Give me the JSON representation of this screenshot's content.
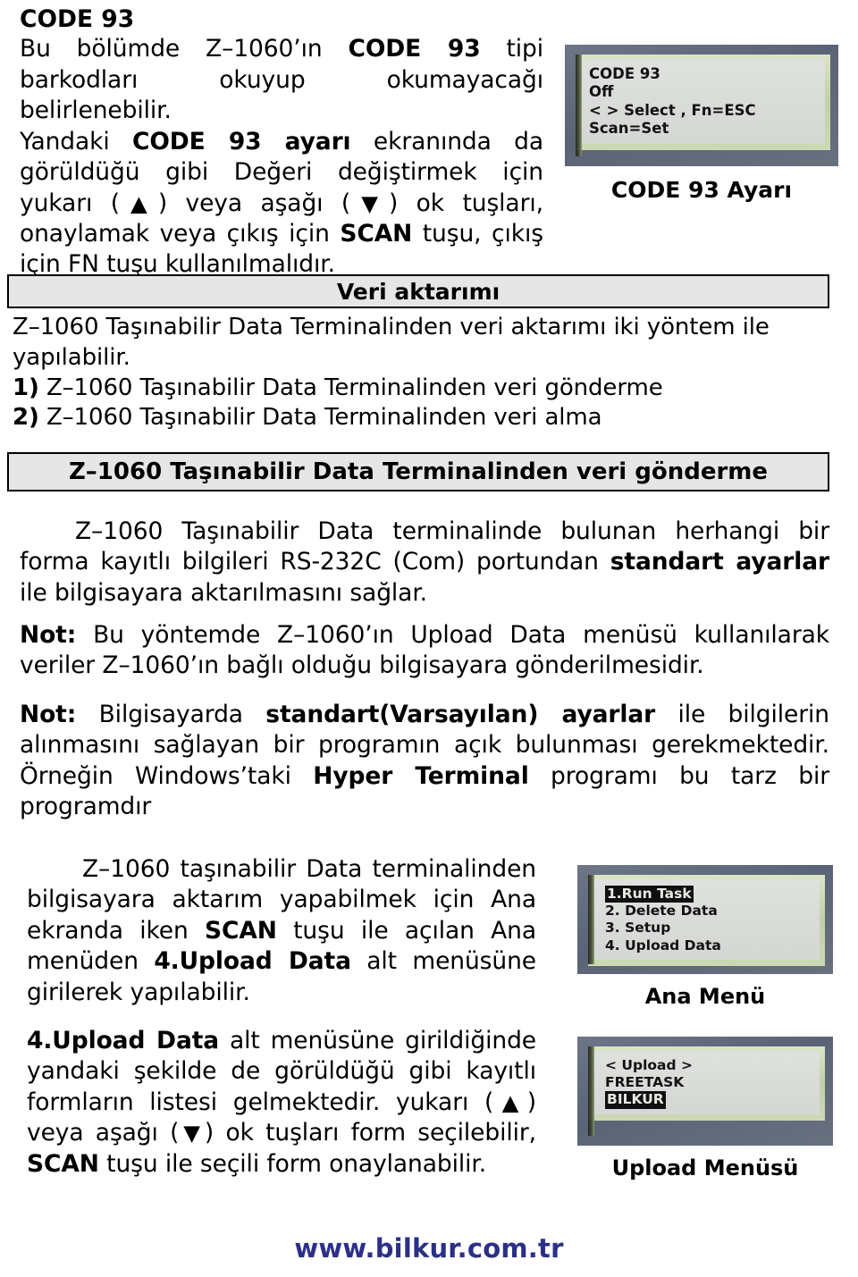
{
  "document": {
    "section_title": "CODE 93",
    "footer_url": "www.bilkur.com.tr",
    "footer_color": "#2b3087"
  },
  "intro": {
    "paragraph1": "Bu bölümde Z–1060’ın CODE 93 tipi barkodları okuyup okumayacağı belirlenebilir.",
    "p1_part1": "Bu bölümde Z–1060’ın ",
    "p1_bold": "CODE 93",
    "p1_part2": " tipi barkodları okuyup okumayacağı belirlenebilir.",
    "p2_part1": "Yandaki ",
    "p2_bold1": "CODE 93 ayarı",
    "p2_part2": " ekranında da görüldüğü gibi Değeri değiştirmek için yukarı (",
    "arrow_up": "▲",
    "p2_part3": ") veya aşağı (",
    "arrow_down": "▼",
    "p2_part4": ") ok tuşları, onaylamak veya çıkış için ",
    "p2_bold2": "SCAN",
    "p2_part5": " tuşu, çıkış için FN tuşu kullanılmalıdır."
  },
  "figure_code93": {
    "caption": "CODE 93 Ayarı",
    "lcd_lines": [
      {
        "text": "CODE 93",
        "highlighted": false
      },
      {
        "text": "Off",
        "highlighted": false
      },
      {
        "text": "< > Select , Fn=ESC",
        "highlighted": false
      },
      {
        "text": "Scan=Set",
        "highlighted": false
      }
    ]
  },
  "veri_aktarimi": {
    "bar_label": "Veri aktarımı",
    "line1": "Z–1060 Taşınabilir Data Terminalinden veri aktarımı iki yöntem ile yapılabilir.",
    "item1_num": "1)",
    "item1_text": " Z–1060 Taşınabilir Data Terminalinden veri gönderme",
    "item2_num": "2)",
    "item2_text": " Z–1060 Taşınabilir Data Terminalinden veri alma"
  },
  "gonderme": {
    "bar_label": "Z–1060 Taşınabilir Data Terminalinden veri gönderme",
    "p1_part1": "Z–1060 Taşınabilir Data terminalinde bulunan herhangi bir forma kayıtlı bilgileri RS-232C (Com) portundan ",
    "p1_bold": "standart ayarlar",
    "p1_part2": " ile bilgisayara aktarılmasını sağlar.",
    "note1_label": "Not:",
    "note1_text": " Bu yöntemde Z–1060’ın Upload Data menüsü kullanılarak veriler Z–1060’ın bağlı olduğu bilgisayara gönderilmesidir.",
    "note2_label": "Not:",
    "note2_part1": " Bilgisayarda ",
    "note2_bold1": "standart(Varsayılan) ayarlar",
    "note2_part2": " ile bilgilerin alınmasını sağlayan bir programın açık bulunması gerekmektedir. Örneğin Windows’taki ",
    "note2_bold2": "Hyper Terminal",
    "note2_part3": " programı bu tarz bir programdır"
  },
  "ana_menu_text": {
    "part1": "Z–1060 taşınabilir Data terminalinden bilgisayara aktarım yapabilmek için Ana ekranda iken ",
    "bold1": "SCAN",
    "part2": " tuşu ile açılan Ana menüden ",
    "bold2": "4.Upload Data",
    "part3": " alt menüsüne girilerek yapılabilir."
  },
  "figure_ana_menu": {
    "caption": "Ana Menü",
    "lcd_lines": [
      {
        "text": "1.Run Task",
        "highlighted": true
      },
      {
        "text": "2. Delete Data",
        "highlighted": false
      },
      {
        "text": "3. Setup",
        "highlighted": false
      },
      {
        "text": "4. Upload Data",
        "highlighted": false
      }
    ]
  },
  "upload_menu_text": {
    "bold1": "4.Upload Data",
    "part1": " alt menüsüne girildiğinde yandaki şekilde de görüldüğü gibi kayıtlı formların listesi gelmektedir. yukarı (",
    "arrow_up": "▲",
    "part2": ") veya aşağı (",
    "arrow_down": "▼",
    "part3": ") ok tuşları form seçilebilir, ",
    "bold2": "SCAN",
    "part4": " tuşu ile seçili form onaylanabilir."
  },
  "figure_upload_menu": {
    "caption": "Upload Menüsü",
    "lcd_lines": [
      {
        "text": "< Upload >",
        "highlighted": false
      },
      {
        "text": "FREETASK",
        "highlighted": false
      },
      {
        "text": "BILKUR",
        "highlighted": true
      }
    ]
  }
}
